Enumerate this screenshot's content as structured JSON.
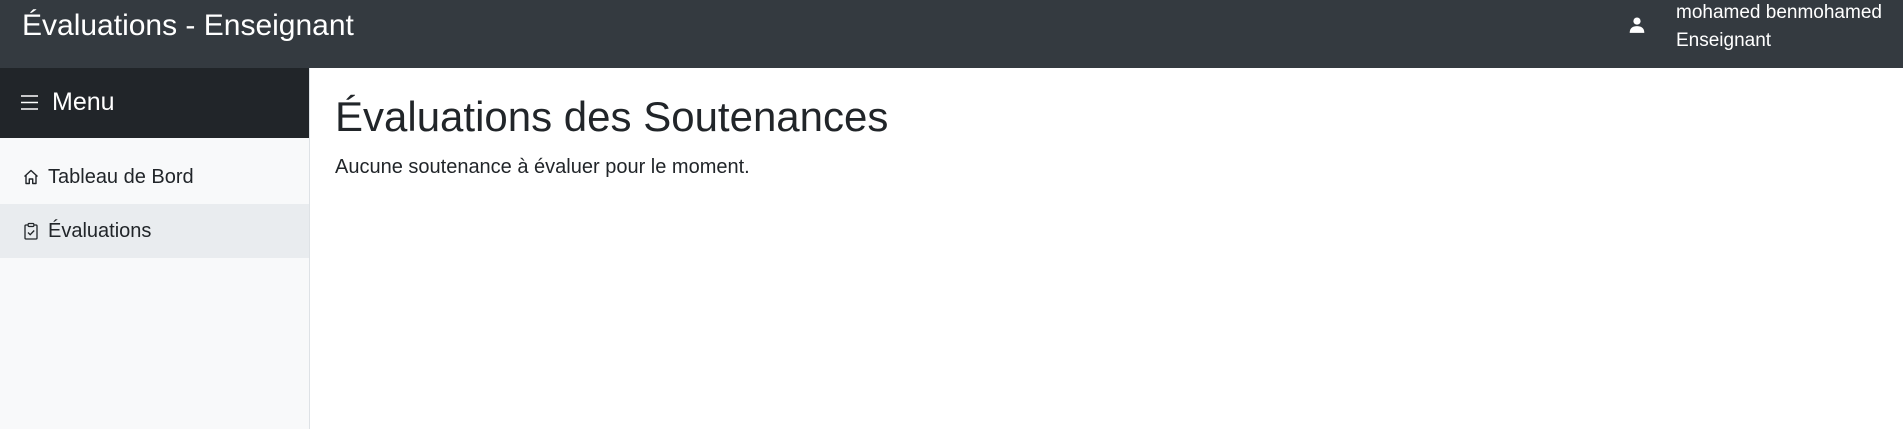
{
  "header": {
    "title": "Évaluations - Enseignant",
    "user_icon": "user-icon",
    "user_name": "mohamed benmohamed",
    "user_role": "Enseignant"
  },
  "sidebar": {
    "menu_icon": "hamburger-icon",
    "menu_title": "Menu",
    "items": [
      {
        "label": "Tableau de Bord",
        "icon": "house-icon",
        "active": false
      },
      {
        "label": "Évaluations",
        "icon": "clipboard-check-icon",
        "active": true
      }
    ]
  },
  "main": {
    "title": "Évaluations des Soutenances",
    "empty_message": "Aucune soutenance à évaluer pour le moment."
  },
  "colors": {
    "topbar": "#343a40",
    "sidebar_header": "#212529",
    "sidebar_bg": "#f8f9fa",
    "active_item": "#e9ecef"
  }
}
